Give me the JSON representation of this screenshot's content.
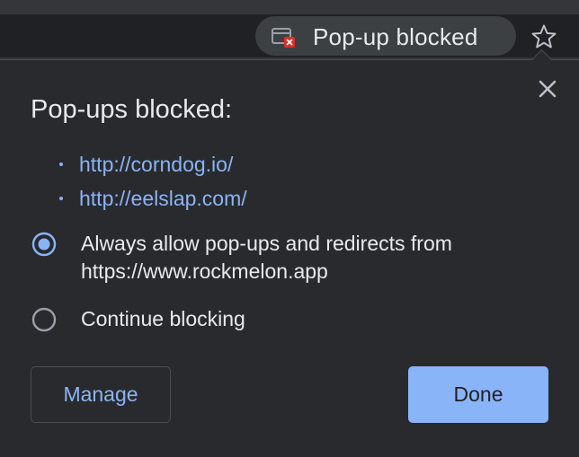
{
  "toolbar": {
    "chip_label": "Pop-up blocked",
    "chip_icon": "popup-blocked-icon",
    "bookmark_icon": "star-icon"
  },
  "bubble": {
    "title": "Pop-ups blocked:",
    "blocked_popups": [
      {
        "url": "http://corndog.io/"
      },
      {
        "url": "http://eelslap.com/"
      }
    ],
    "options": [
      {
        "label": "Always allow pop-ups and redirects from https://www.rockmelon.app",
        "selected": true
      },
      {
        "label": "Continue blocking",
        "selected": false
      }
    ],
    "manage_label": "Manage",
    "done_label": "Done",
    "close_icon": "close-icon"
  },
  "colors": {
    "accent": "#8ab4f8",
    "bubble_bg": "#292a2d",
    "text": "#e8eaed",
    "error": "#d93025"
  }
}
